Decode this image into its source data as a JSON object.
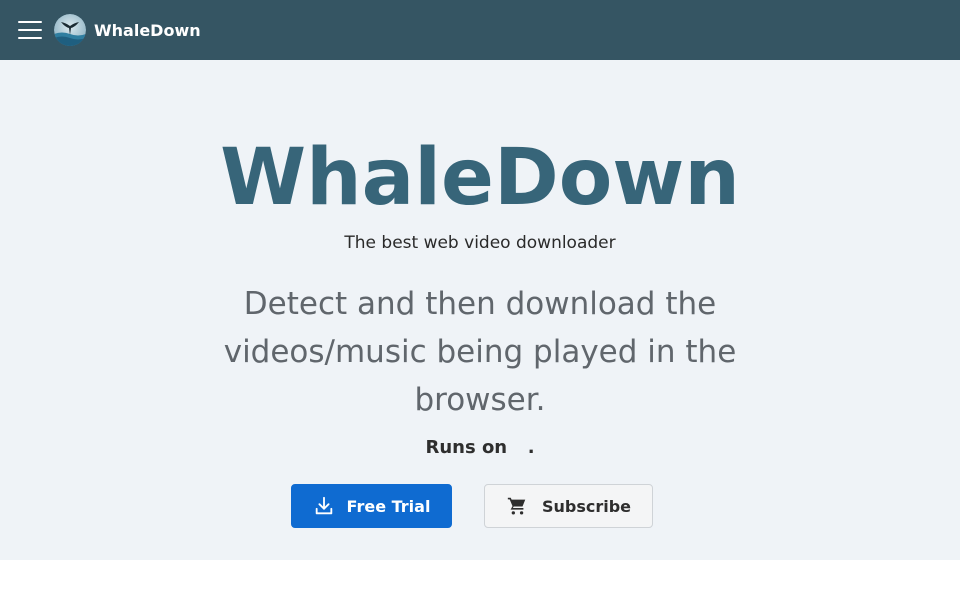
{
  "navbar": {
    "menu_icon": "hamburger-menu-icon",
    "brand_name": "WhaleDown",
    "logo_icon": "whale-tail-logo",
    "background": "#355563"
  },
  "hero": {
    "title": "WhaleDown",
    "tagline": "The best web video downloader",
    "description": "Detect and then download the videos/music being played in the browser.",
    "runs_on_label": "Runs on",
    "runs_on_suffix": ".",
    "title_color": "#376579",
    "background": "#eff3f7"
  },
  "actions": {
    "free_trial_label": "Free Trial",
    "free_trial_icon": "download-icon",
    "subscribe_label": "Subscribe",
    "subscribe_icon": "cart-icon",
    "primary_color": "#0f6bd1"
  }
}
